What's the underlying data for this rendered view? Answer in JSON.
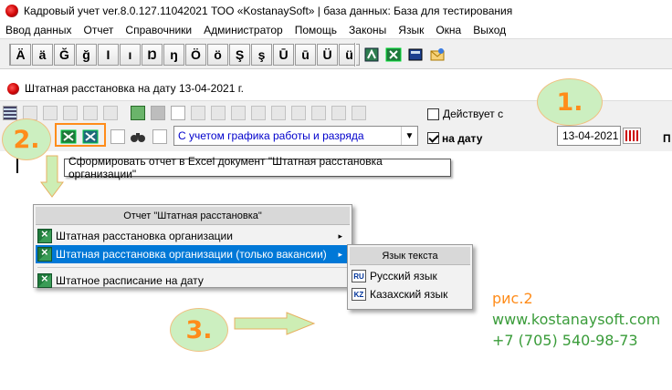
{
  "window": {
    "title": "Кадровый учет ver.8.0.127.11042021 ТОО «KostanaySoft» | база данных: База для тестирования"
  },
  "menu": [
    "Ввод данных",
    "Отчет",
    "Справочники",
    "Администратор",
    "Помощь",
    "Законы",
    "Язык",
    "Окна",
    "Выход"
  ],
  "char_buttons": [
    "Ä",
    "ä",
    "Ğ",
    "ğ",
    "I",
    "ı",
    "Ŋ",
    "ŋ",
    "Ö",
    "ö",
    "Ş",
    "ş",
    "Ū",
    "ū",
    "Ü",
    "ü"
  ],
  "child_window": {
    "title": "Штатная расстановка на дату 13-04-2021 г."
  },
  "toolbar": {
    "deistvuet_label": "Действует с",
    "na_datu_label": "на дату",
    "mode_combo_value": "С учетом графика работы и разряда",
    "date_value": "13-04-2021",
    "cut_label": "П"
  },
  "tooltip": "Сформировать отчет в Excel документ \"Штатная расстановка организации\"",
  "report_menu": {
    "header": "Отчет \"Штатная расстановка\"",
    "items": [
      {
        "label": "Штатная расстановка организации",
        "submenu": "▸"
      },
      {
        "label": "Штатная расстановка организации (только вакансии)",
        "submenu": "▸"
      },
      {
        "label": "Штатное расписание на дату"
      }
    ]
  },
  "language_menu": {
    "header": "Язык текста",
    "items": [
      {
        "code": "RU",
        "label": "Русский язык"
      },
      {
        "code": "KZ",
        "label": "Казахский язык"
      }
    ]
  },
  "callouts": {
    "step1": "1.",
    "step2": "2.",
    "step3": "3."
  },
  "contact": {
    "figure": "рис.2",
    "site": "www.kostanaysoft.com",
    "phone": "+7 (705) 540-98-73"
  },
  "colors": {
    "accent_orange": "#ff8c1a",
    "callout_fill": "#ccefc0",
    "menu_highlight": "#0078d7",
    "contact_green": "#3a9c3a",
    "combo_text": "#0000cc"
  }
}
